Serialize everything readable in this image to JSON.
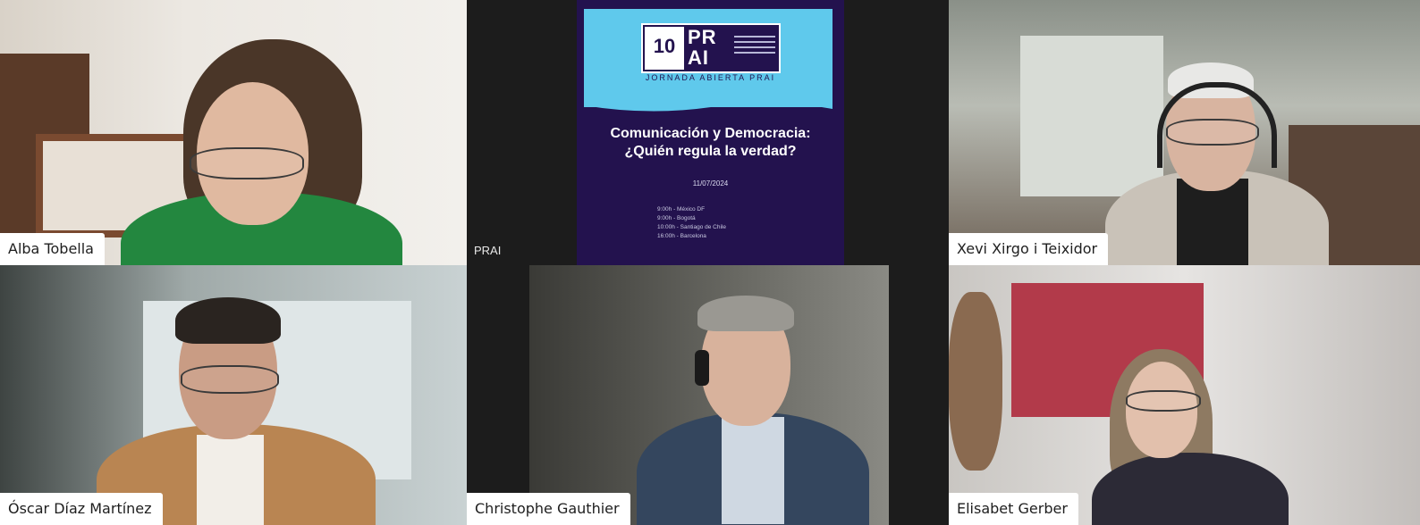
{
  "meeting": {
    "content_share": {
      "owner_label": "PRAI",
      "slide": {
        "logo_badge": "10",
        "logo_text_top": "PR",
        "logo_text_bottom": "AI",
        "event": "JORNADA ABIERTA PRAI",
        "title_line1": "Comunicación y Democracia:",
        "title_line2": "¿Quién regula la verdad?",
        "date": "11/07/2024",
        "schedule": [
          "9:00h - México DF",
          "9:00h - Bogotá",
          "10:00h - Santiago de Chile",
          "16:00h - Barcelona"
        ]
      },
      "colors": {
        "slide_bg": "#23124e",
        "banner": "#5fc9ec"
      }
    },
    "participants": [
      {
        "name": "Alba Tobella"
      },
      {
        "name": "Xevi Xirgo i Teixidor"
      },
      {
        "name": "Óscar Díaz Martínez"
      },
      {
        "name": "Christophe Gauthier"
      },
      {
        "name": "Elisabet Gerber"
      }
    ]
  }
}
